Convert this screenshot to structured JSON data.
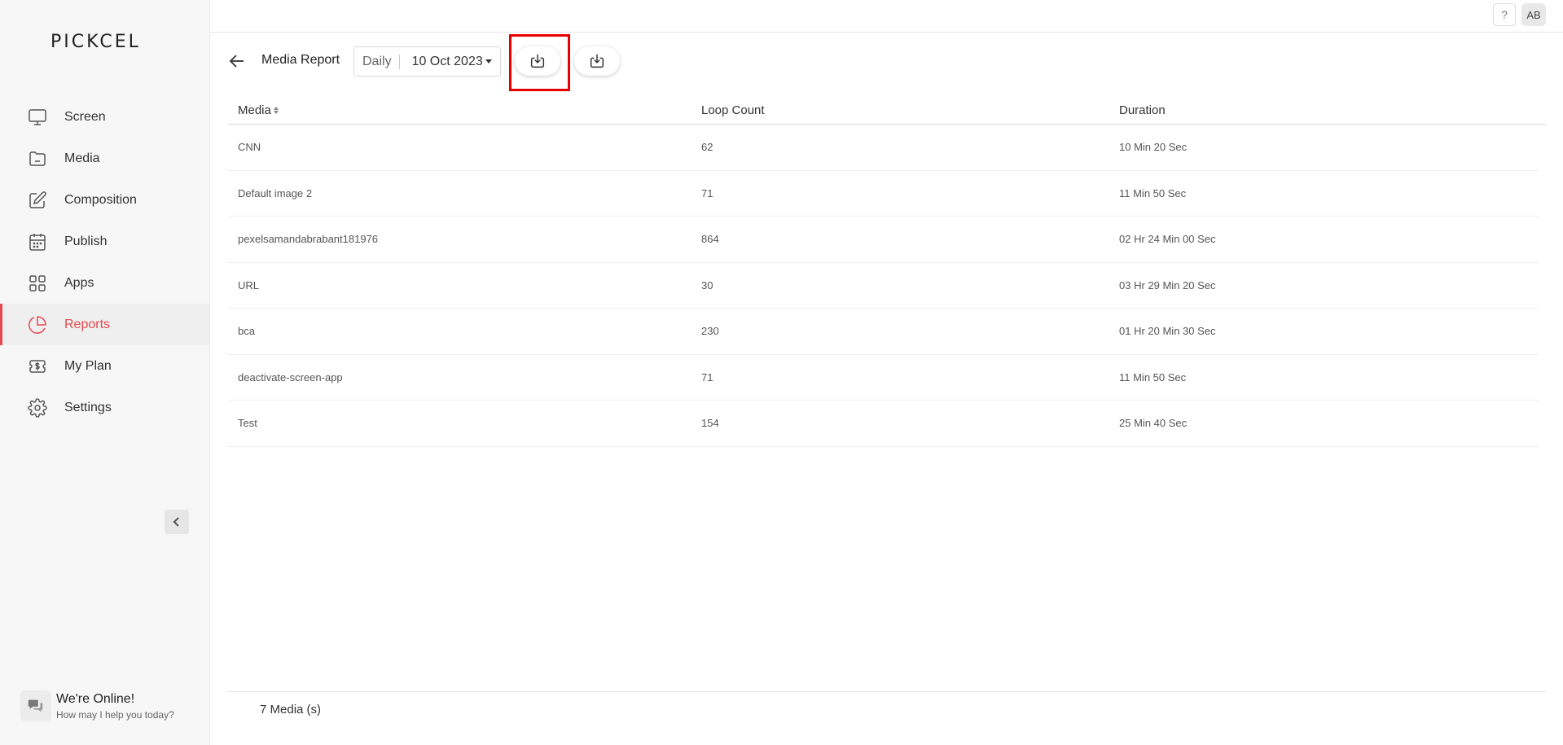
{
  "app": {
    "logo_text": "PICKCEL"
  },
  "sidebar": {
    "items": [
      {
        "label": "Screen",
        "icon": "monitor-icon",
        "active": false
      },
      {
        "label": "Media",
        "icon": "folder-icon",
        "active": false
      },
      {
        "label": "Composition",
        "icon": "edit-icon",
        "active": false
      },
      {
        "label": "Publish",
        "icon": "calendar-icon",
        "active": false
      },
      {
        "label": "Apps",
        "icon": "grid-icon",
        "active": false
      },
      {
        "label": "Reports",
        "icon": "pie-chart-icon",
        "active": true
      },
      {
        "label": "My Plan",
        "icon": "dollar-ticket-icon",
        "active": false
      },
      {
        "label": "Settings",
        "icon": "gear-icon",
        "active": false
      }
    ],
    "accent_color": "#e5484d",
    "chat": {
      "title": "We're Online!",
      "subtitle": "How may I help you today?"
    }
  },
  "topbar": {
    "help_label": "?",
    "avatar_initials": "AB"
  },
  "header": {
    "title": "Media Report",
    "period_type": "Daily",
    "period_date": "10 Oct 2023"
  },
  "table": {
    "columns": [
      "Media",
      "Loop Count",
      "Duration"
    ],
    "rows": [
      {
        "media": "CNN",
        "loop_count": "62",
        "duration": "10 Min 20 Sec"
      },
      {
        "media": "Default image 2",
        "loop_count": "71",
        "duration": "11 Min 50 Sec"
      },
      {
        "media": "pexelsamandabrabant181976",
        "loop_count": "864",
        "duration": "02 Hr 24 Min 00 Sec"
      },
      {
        "media": "URL",
        "loop_count": "30",
        "duration": "03 Hr 29 Min 20 Sec"
      },
      {
        "media": "bca",
        "loop_count": "230",
        "duration": "01 Hr 20 Min 30 Sec"
      },
      {
        "media": "deactivate-screen-app",
        "loop_count": "71",
        "duration": "11 Min 50 Sec"
      },
      {
        "media": "Test",
        "loop_count": "154",
        "duration": "25 Min 40 Sec"
      }
    ]
  },
  "footer": {
    "count_label": "7 Media (s)"
  }
}
